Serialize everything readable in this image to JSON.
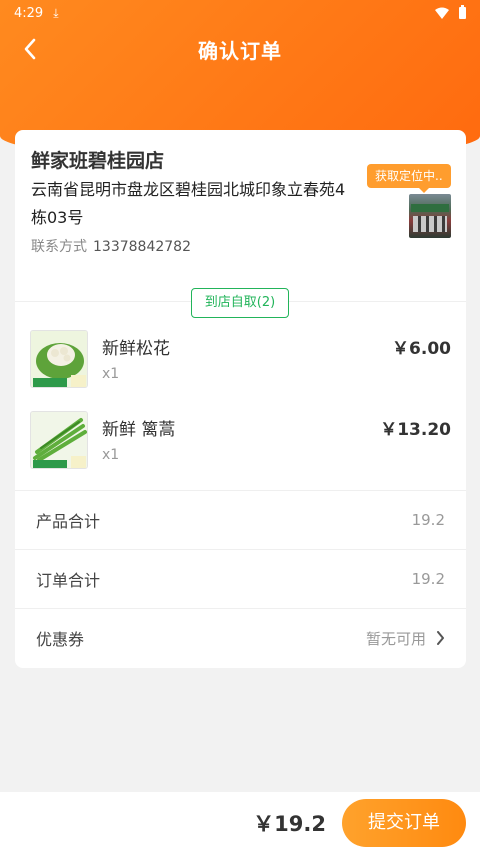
{
  "status_bar": {
    "time": "4:29"
  },
  "header": {
    "title": "确认订单"
  },
  "store": {
    "name": "鲜家班碧桂园店",
    "address": "云南省昆明市盘龙区碧桂园北城印象立春苑4栋03号",
    "contact_label": "联系方式",
    "phone": "13378842782",
    "location_badge": "获取定位中.."
  },
  "pickup_tag": "到店自取(2)",
  "items": [
    {
      "name": "新鲜松花",
      "qty": "x1",
      "price": "￥6.00",
      "icon": "cauliflower-image"
    },
    {
      "name": "新鲜 篱蒿",
      "qty": "x1",
      "price": "￥13.20",
      "icon": "asparagus-image"
    }
  ],
  "summary": {
    "product_total_label": "产品合计",
    "product_total": "19.2",
    "order_total_label": "订单合计",
    "order_total": "19.2",
    "coupon_label": "优惠券",
    "coupon_value": "暂无可用"
  },
  "footer": {
    "total": "￥19.2",
    "submit_label": "提交订单"
  },
  "colors": {
    "accent": "#ff7a17",
    "green": "#22b45a",
    "background": "#f2f2f2"
  }
}
